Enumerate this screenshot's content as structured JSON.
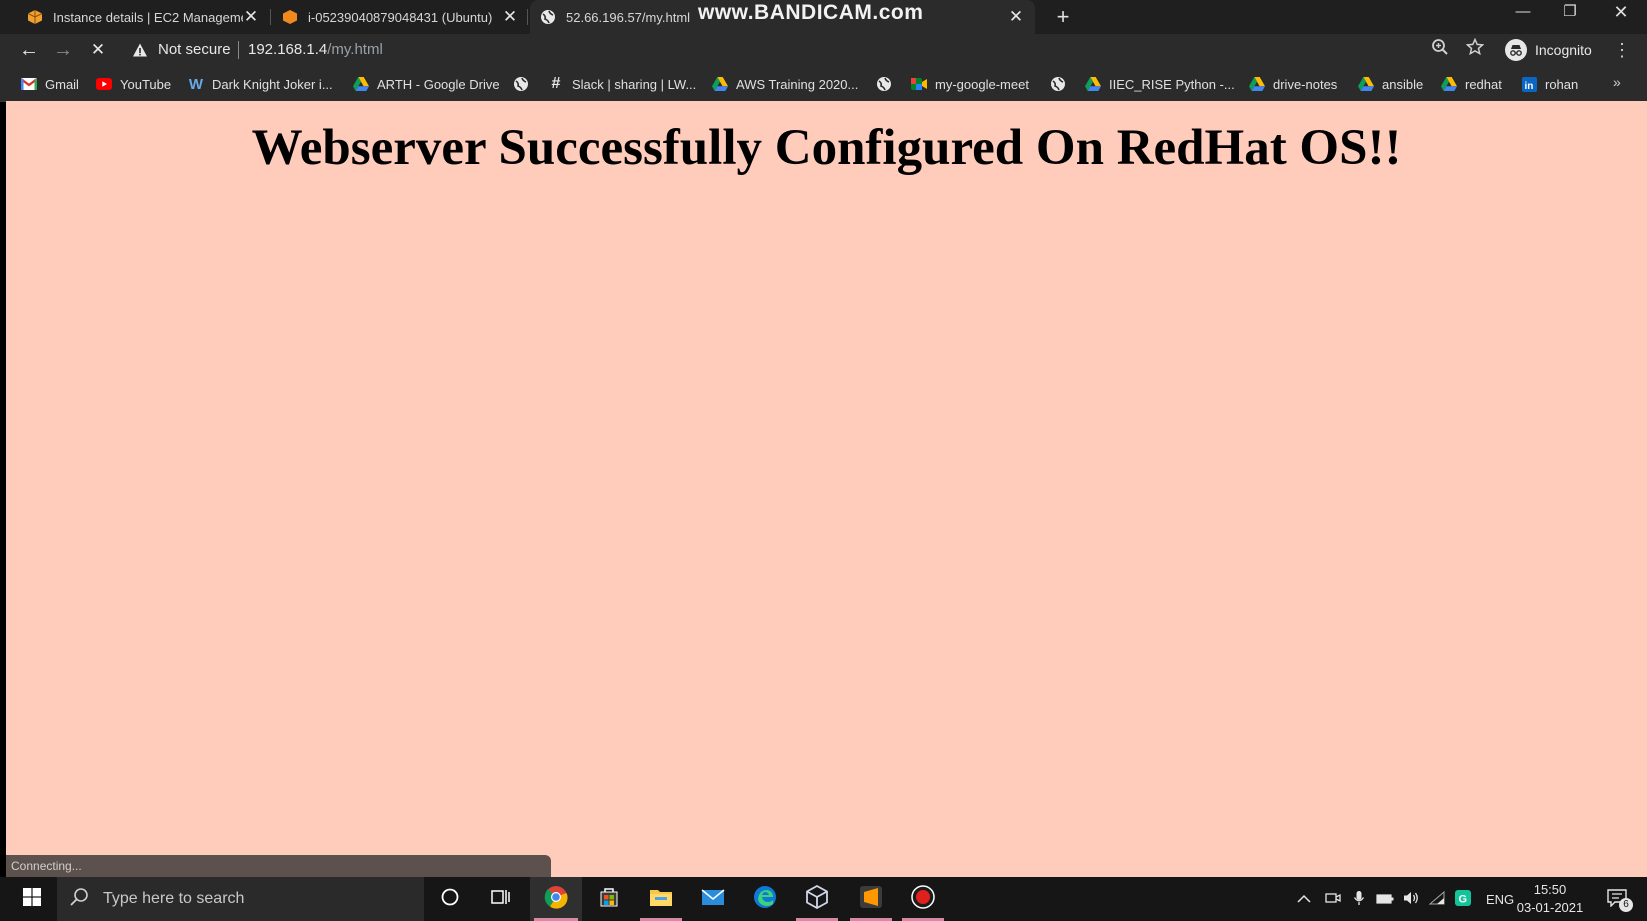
{
  "watermark": "www.BANDICAM.com",
  "tabs": [
    {
      "title": "Instance details | EC2 Manageme",
      "close": "✕"
    },
    {
      "title": "i-05239040879048431 (Ubuntu) |",
      "close": "✕"
    },
    {
      "title": "52.66.196.57/my.html",
      "close": "✕"
    }
  ],
  "new_tab": "+",
  "window": {
    "minimize": "—",
    "restore": "❐",
    "close": "✕"
  },
  "nav": {
    "back": "←",
    "forward": "→",
    "stop": "✕"
  },
  "omnibox": {
    "security": "Not secure",
    "host": "192.168.1.4",
    "path": "/my.html"
  },
  "profile": {
    "label": "Incognito"
  },
  "menu": "⋮",
  "bookmarks": [
    {
      "label": "Gmail",
      "icon": "gmail-icon"
    },
    {
      "label": "YouTube",
      "icon": "youtube-icon"
    },
    {
      "label": "Dark Knight Joker i...",
      "icon": "wordpress-icon"
    },
    {
      "label": "ARTH - Google Drive",
      "icon": "drive-icon"
    },
    {
      "label": "",
      "icon": "globe-icon"
    },
    {
      "label": "Slack | sharing | LW...",
      "icon": "slack-icon"
    },
    {
      "label": "AWS Training 2020...",
      "icon": "drive-icon"
    },
    {
      "label": "",
      "icon": "globe-icon"
    },
    {
      "label": "my-google-meet",
      "icon": "meet-icon"
    },
    {
      "label": "",
      "icon": "globe-icon"
    },
    {
      "label": "IIEC_RISE Python -...",
      "icon": "drive-icon"
    },
    {
      "label": "drive-notes",
      "icon": "drive-icon"
    },
    {
      "label": "ansible",
      "icon": "drive-icon"
    },
    {
      "label": "redhat",
      "icon": "drive-icon"
    },
    {
      "label": "rohan",
      "icon": "linkedin-icon"
    }
  ],
  "bookmarks_more": "»",
  "page": {
    "heading": "Webserver Successfully Configured On RedHat OS!!",
    "background": "#ffcbbb"
  },
  "status": "Connecting...",
  "taskbar": {
    "search_placeholder": "Type here to search",
    "language": "ENG",
    "time": "15:50",
    "date": "03-01-2021",
    "notifications": "6"
  }
}
